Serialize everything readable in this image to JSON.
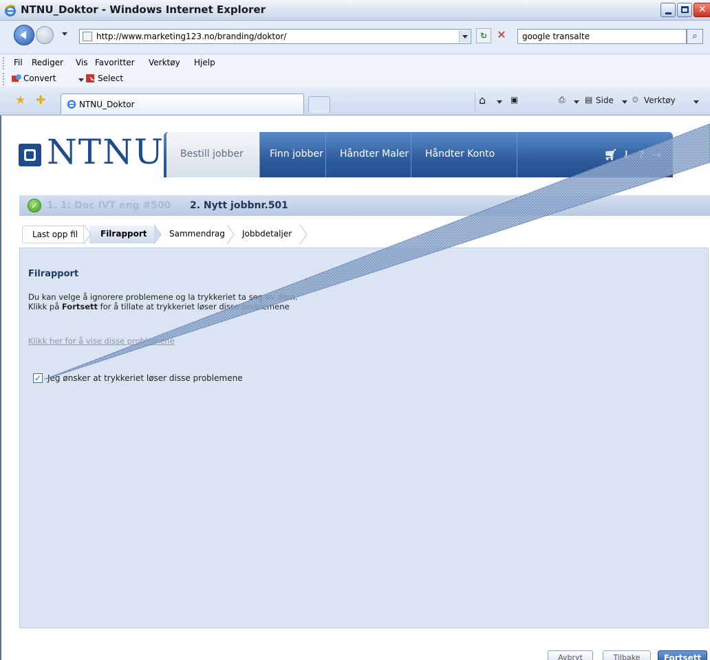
{
  "window": {
    "title": "NTNU_Doktor - Windows Internet Explorer"
  },
  "address": {
    "url": "http://www.marketing123.no/branding/doktor/",
    "search_value": "google transalte"
  },
  "menu": [
    "Fil",
    "Rediger",
    "Vis",
    "Favoritter",
    "Verktøy",
    "Hjelp"
  ],
  "toolbar": {
    "convert": "Convert",
    "select": "Select"
  },
  "tab": {
    "label": "NTNU_Doktor"
  },
  "commands": {
    "side": "Side",
    "verktoy": "Verktøy"
  },
  "site": {
    "logo": "NTNU",
    "nav": [
      "Bestill jobber",
      "Finn jobber",
      "Håndter Maler",
      "Håndter Konto"
    ],
    "utils": [
      "cart-icon",
      "download-icon",
      "help-icon",
      "logout-icon"
    ]
  },
  "steps": {
    "step1": "1. 1: Doc IVT eng #500",
    "step2": "2. Nytt jobbnr.501"
  },
  "wizard": [
    "Last opp fil",
    "Filrapport",
    "Sammendrag",
    "Jobbdetaljer"
  ],
  "panel": {
    "heading": "Filrapport",
    "line1": "Du kan velge å ignorere problemene og la trykkeriet ta seg av dem.",
    "line2_pre": "Klikk på ",
    "line2_bold": "Fortsett",
    "line2_post": " for å tillate at trykkeriet løser disse problemene",
    "link": "Klikk her for å vise disse problemene",
    "checkbox_label": "Jeg ønsker at trykkeriet løser disse problemene",
    "checkbox_checked": true
  },
  "buttons": {
    "cancel": "Avbryt",
    "back": "Tilbake",
    "continue": "Fortsett"
  },
  "colors": {
    "brand": "#1e4b8d",
    "panel": "#dae4f2",
    "nav": "#2e5c9c"
  }
}
